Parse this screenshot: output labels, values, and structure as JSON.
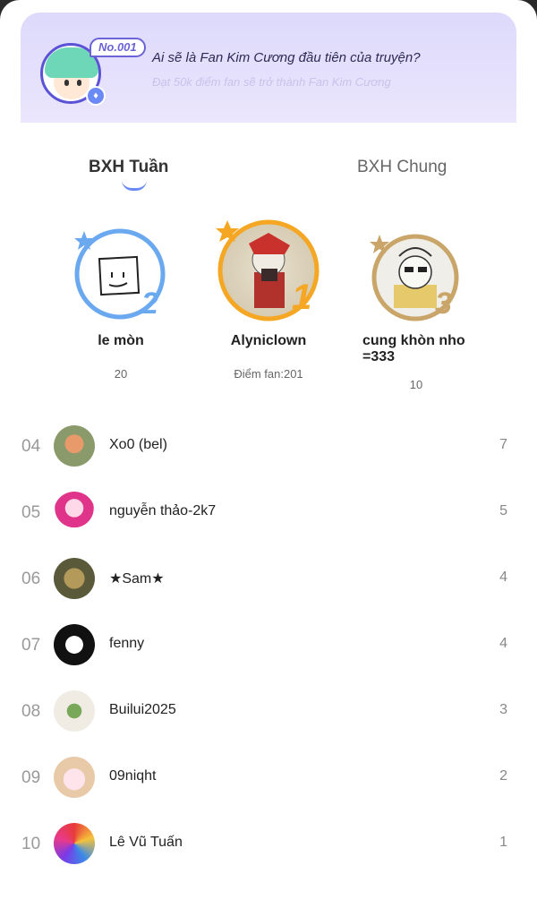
{
  "banner": {
    "tag": "No.001",
    "title": "Ai sẽ là Fan Kim Cương đầu tiên của truyện?",
    "subtitle": "Đạt 50k điểm fan sẽ trở thành Fan Kim Cương"
  },
  "tabs": {
    "weekly": "BXH Tuần",
    "general": "BXH Chung"
  },
  "podium": {
    "first": {
      "rank": "1",
      "name": "Alyniclown",
      "score": "Điểm fan:201"
    },
    "second": {
      "rank": "2",
      "name": "le mòn",
      "score": "20"
    },
    "third": {
      "rank": "3",
      "name": "cung khòn nho =333",
      "score": "10"
    }
  },
  "list": [
    {
      "rank": "04",
      "name": "Xo0 (bel)",
      "score": "7"
    },
    {
      "rank": "05",
      "name": "nguyễn thảo-2k7",
      "score": "5"
    },
    {
      "rank": "06",
      "name": "★Sam★",
      "score": "4"
    },
    {
      "rank": "07",
      "name": "fenny",
      "score": "4"
    },
    {
      "rank": "08",
      "name": "Builui2025",
      "score": "3"
    },
    {
      "rank": "09",
      "name": "09niqht",
      "score": "2"
    },
    {
      "rank": "10",
      "name": "Lê Vũ Tuấn",
      "score": "1"
    }
  ],
  "colors": {
    "accent": "#6b8af5",
    "gold": "#f5a623",
    "silver": "#6aa8f0",
    "bronze": "#c9a56a"
  }
}
